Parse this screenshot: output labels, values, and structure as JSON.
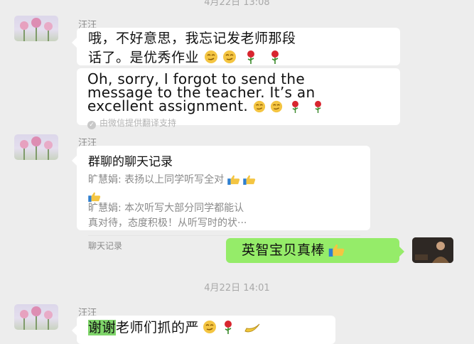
{
  "timestamps": {
    "top": "4月22日 13:08",
    "middle": "4月22日 14:01"
  },
  "sender_name": "汪汪",
  "messages": {
    "m1": {
      "line1": "哦，不好意思，我忘记发老师那段",
      "line2": "话了。是优秀作业"
    },
    "translation": {
      "line1": "Oh, sorry, I forgot to send the",
      "line2": "message to the teacher. It’s an",
      "line3": "excellent assignment.",
      "note": "由微信提供翻译支持"
    },
    "card": {
      "title": "群聊的聊天记录",
      "line1": "旷慧娟: 表扬以上同学听写全对",
      "line2": "旷慧娟: 本次听写大部分同学都能认",
      "line3": "真对待，态度积极！从听写时的状···",
      "footer": "聊天记录"
    },
    "sent": {
      "text": "英智宝贝真棒"
    },
    "last": {
      "highlighted": "谢谢",
      "rest": "老师们抓的严"
    }
  },
  "icons": [
    "smirk-emoji",
    "rose-emoji",
    "thumbs-up-emoji",
    "banana-emoji",
    "check-icon"
  ]
}
